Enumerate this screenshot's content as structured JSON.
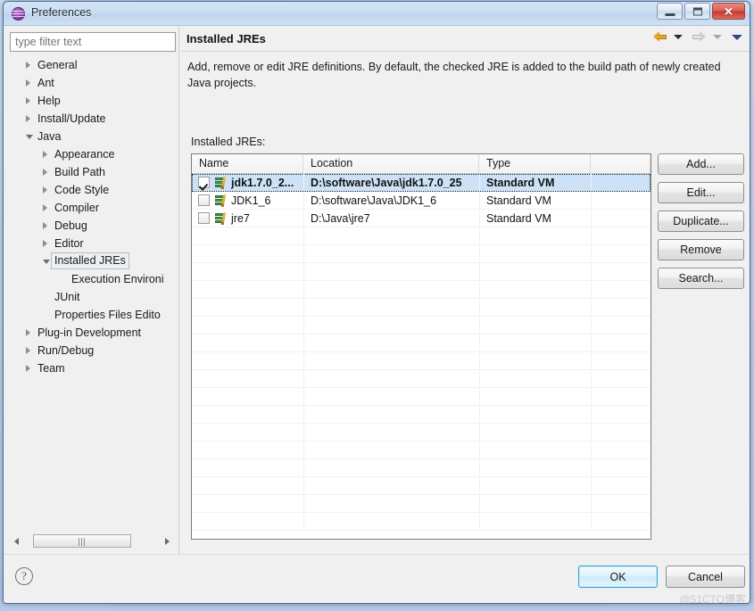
{
  "window": {
    "title": "Preferences",
    "icon": "preferences-sphere-icon",
    "controls": {
      "minimize": "minimize-icon",
      "maximize": "maximize-icon",
      "close": "close-icon"
    }
  },
  "filter": {
    "placeholder": "type filter text",
    "value": ""
  },
  "tree": [
    {
      "label": "General",
      "level": 1,
      "state": "collapsed",
      "selected": false
    },
    {
      "label": "Ant",
      "level": 1,
      "state": "collapsed",
      "selected": false
    },
    {
      "label": "Help",
      "level": 1,
      "state": "collapsed",
      "selected": false
    },
    {
      "label": "Install/Update",
      "level": 1,
      "state": "collapsed",
      "selected": false
    },
    {
      "label": "Java",
      "level": 1,
      "state": "expanded",
      "selected": false
    },
    {
      "label": "Appearance",
      "level": 2,
      "state": "collapsed",
      "selected": false
    },
    {
      "label": "Build Path",
      "level": 2,
      "state": "collapsed",
      "selected": false
    },
    {
      "label": "Code Style",
      "level": 2,
      "state": "collapsed",
      "selected": false
    },
    {
      "label": "Compiler",
      "level": 2,
      "state": "collapsed",
      "selected": false
    },
    {
      "label": "Debug",
      "level": 2,
      "state": "collapsed",
      "selected": false
    },
    {
      "label": "Editor",
      "level": 2,
      "state": "collapsed",
      "selected": false
    },
    {
      "label": "Installed JREs",
      "level": 2,
      "state": "expanded",
      "selected": true
    },
    {
      "label": "Execution Environi",
      "level": 3,
      "state": "leaf",
      "selected": false
    },
    {
      "label": "JUnit",
      "level": 2,
      "state": "leaf",
      "selected": false
    },
    {
      "label": "Properties Files Edito",
      "level": 2,
      "state": "leaf",
      "selected": false
    },
    {
      "label": "Plug-in Development",
      "level": 1,
      "state": "collapsed",
      "selected": false
    },
    {
      "label": "Run/Debug",
      "level": 1,
      "state": "collapsed",
      "selected": false
    },
    {
      "label": "Team",
      "level": 1,
      "state": "collapsed",
      "selected": false
    }
  ],
  "page": {
    "title": "Installed JREs",
    "description": "Add, remove or edit JRE definitions. By default, the checked JRE is added to the build path of newly created Java projects.",
    "table_label": "Installed JREs:",
    "nav": {
      "back_icon": "back-arrow-icon",
      "back_menu_icon": "chevron-down-icon",
      "forward_icon": "forward-arrow-icon",
      "forward_menu_icon": "chevron-down-icon",
      "overflow_menu_icon": "chevron-down-icon"
    }
  },
  "table": {
    "columns": [
      "Name",
      "Location",
      "Type",
      ""
    ],
    "rows": [
      {
        "checked": true,
        "icon": "jre-library-icon",
        "name": "jdk1.7.0_2...",
        "location": "D:\\software\\Java\\jdk1.7.0_25",
        "type": "Standard VM",
        "selected": true
      },
      {
        "checked": false,
        "icon": "jre-library-icon",
        "name": "JDK1_6",
        "location": "D:\\software\\Java\\JDK1_6",
        "type": "Standard VM",
        "selected": false
      },
      {
        "checked": false,
        "icon": "jre-library-icon",
        "name": "jre7",
        "location": "D:\\Java\\jre7",
        "type": "Standard VM",
        "selected": false
      }
    ]
  },
  "side_buttons": [
    {
      "label": "Add..."
    },
    {
      "label": "Edit..."
    },
    {
      "label": "Duplicate..."
    },
    {
      "label": "Remove"
    },
    {
      "label": "Search..."
    }
  ],
  "footer": {
    "help_icon": "question-mark-icon",
    "ok_label": "OK",
    "cancel_label": "Cancel",
    "watermark": "@51CTO博客"
  },
  "colors": {
    "selection_blue": "#cde2f7",
    "default_button_border": "#2da3d8",
    "titlebar_blue": "#cadef3",
    "close_red": "#c7372a",
    "nav_back_yellow": "#e8a72b",
    "jre_icon_green": "#4fae58"
  }
}
